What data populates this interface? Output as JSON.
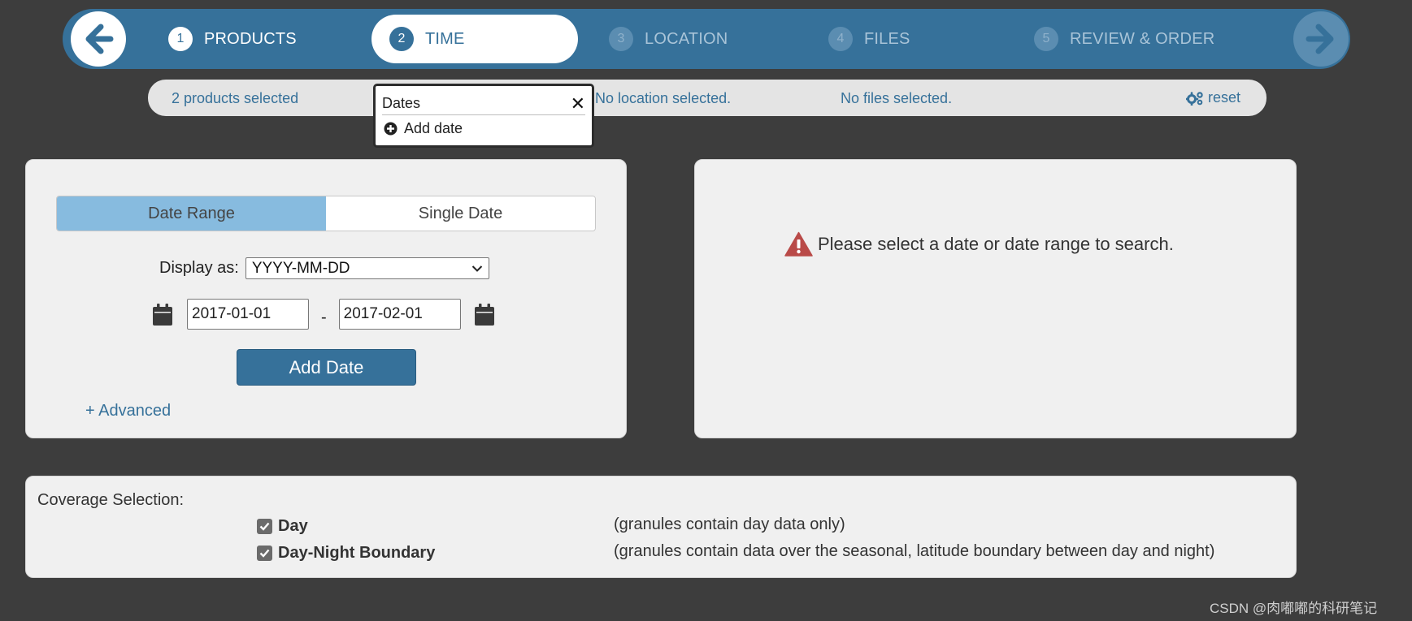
{
  "steps": [
    {
      "num": "1",
      "label": "PRODUCTS",
      "state": "done"
    },
    {
      "num": "2",
      "label": "TIME",
      "state": "active"
    },
    {
      "num": "3",
      "label": "LOCATION",
      "state": "inactive"
    },
    {
      "num": "4",
      "label": "FILES",
      "state": "inactive"
    },
    {
      "num": "5",
      "label": "REVIEW & ORDER",
      "state": "inactive"
    }
  ],
  "summary": {
    "products": "2 products selected",
    "location": "No location selected.",
    "files": "No files selected.",
    "reset": "reset"
  },
  "popup": {
    "title": "Dates",
    "add_label": "Add date"
  },
  "date_form": {
    "tabs": [
      "Date Range",
      "Single Date"
    ],
    "selected_tab": "Date Range",
    "display_as_label": "Display as:",
    "display_format": "YYYY-MM-DD",
    "start_date": "2017-01-01",
    "separator": "-",
    "end_date": "2017-02-01",
    "add_button": "Add Date",
    "advanced_link": "+ Advanced"
  },
  "message": {
    "text": "Please select a date or date range to search."
  },
  "coverage": {
    "title": "Coverage Selection:",
    "options": [
      {
        "label": "Day",
        "checked": true,
        "desc": "(granules contain day data only)"
      },
      {
        "label": "Day-Night Boundary",
        "checked": true,
        "desc": "(granules contain data over the seasonal, latitude boundary between day and night)"
      }
    ]
  },
  "watermark": "CSDN @肉嘟嘟的科研笔记",
  "colors": {
    "background": "#3d3d3d",
    "primary": "#36719a",
    "tab_selected": "#87bbdf",
    "warning": "#b94a48"
  }
}
